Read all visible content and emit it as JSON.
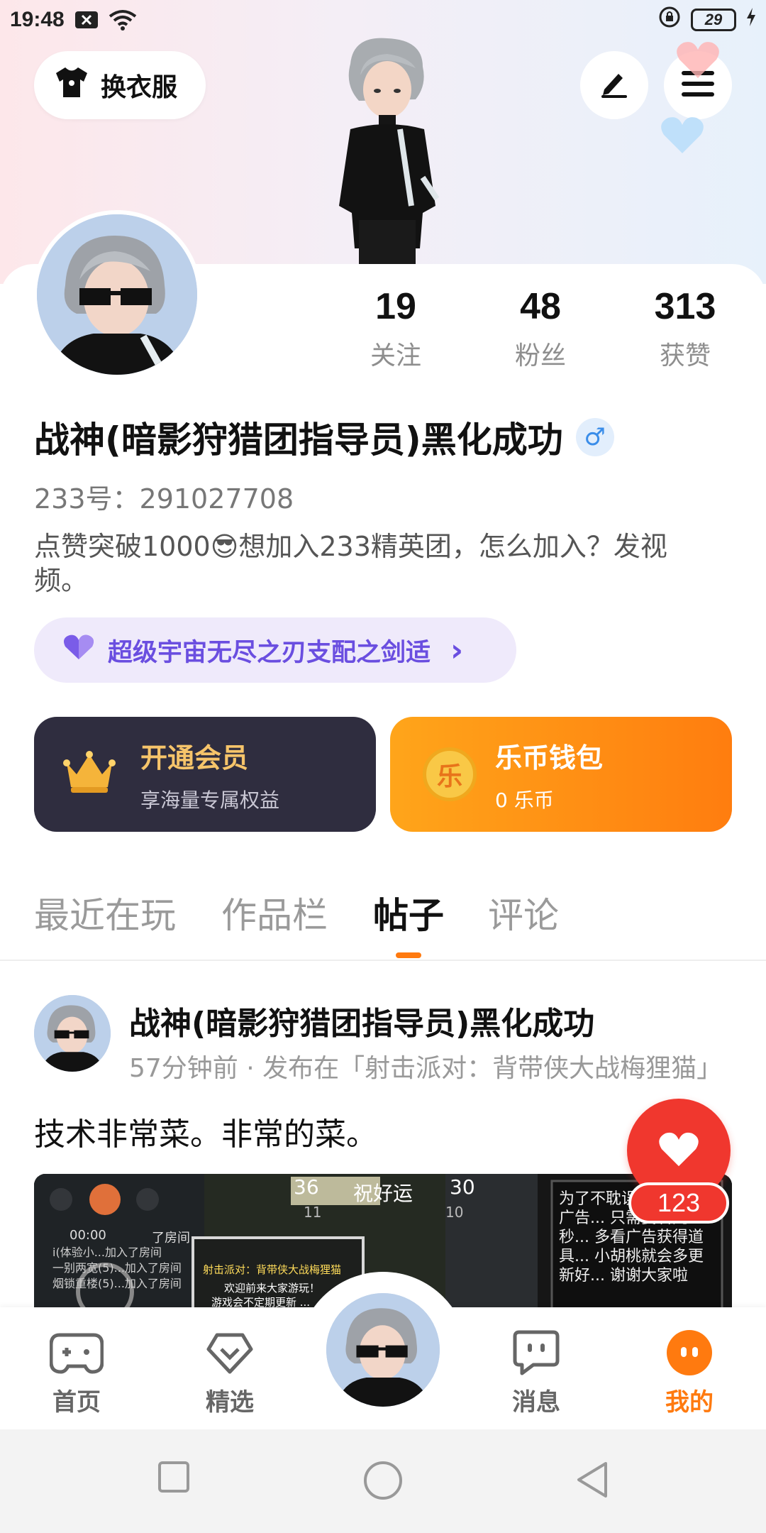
{
  "status_bar": {
    "time": "19:48",
    "battery": "29",
    "icons": [
      "notification-x-icon",
      "wifi-icon",
      "rotation-lock-icon",
      "charging-icon"
    ]
  },
  "header": {
    "outfit_button": "换衣服",
    "edit_icon": "pen-icon",
    "menu_icon": "hamburger-icon"
  },
  "profile": {
    "stats": [
      {
        "value": "19",
        "label": "关注"
      },
      {
        "value": "48",
        "label": "粉丝"
      },
      {
        "value": "313",
        "label": "获赞"
      }
    ],
    "username": "战神(暗影狩猎团指导员)黑化成功",
    "gender_symbol": "♂",
    "uid": "233号：291027708",
    "bio_part1": "点赞突破1000",
    "bio_emoji": "😎",
    "bio_part2": "想加入233精英团，怎么加入？发视频。",
    "title_chip": "超级宇宙无尽之刃支配之剑适",
    "title_chip_arrow": "›"
  },
  "cards": {
    "vip": {
      "title": "开通会员",
      "subtitle": "享海量专属权益"
    },
    "wallet": {
      "coin_glyph": "乐",
      "title": "乐币钱包",
      "subtitle": "0 乐币"
    }
  },
  "tabs": [
    {
      "label": "最近在玩",
      "active": false
    },
    {
      "label": "作品栏",
      "active": false
    },
    {
      "label": "帖子",
      "active": true
    },
    {
      "label": "评论",
      "active": false
    }
  ],
  "post": {
    "author": "战神(暗影狩猎团指导员)黑化成功",
    "meta": "57分钟前 · 发布在「射击派对：背带侠大战梅狸猫」",
    "text": "技术非常菜。非常的菜。",
    "image_overlay": {
      "score_left": "36",
      "center_banner": "祝好运",
      "score_right": "30",
      "players_left": "11",
      "players_right": "10",
      "timer": "00:00",
      "chat_lines": [
        "i(体验小...加入了房间",
        "一别两宽(5)...加入了房间",
        "烟锁重楼(5)...加入了房间"
      ],
      "room_join": "了房间",
      "board_title": "射击派对：背带侠大战梅狸猫",
      "board_line1": "欢迎前来大家游玩！",
      "board_line2": "游戏会不定期更新 ...",
      "sign_text": "为了不耽误... 这里的广告... 只需要看几秒... 多看广告获得道具... 小胡桃就会多更新好... 谢谢大家啦"
    },
    "like_count": "123"
  },
  "bottom_nav": [
    {
      "label": "首页",
      "icon": "gamepad-icon",
      "active": false
    },
    {
      "label": "精选",
      "icon": "heart-gem-icon",
      "active": false
    },
    {
      "label": "消息",
      "icon": "chat-bubble-icon",
      "active": false
    },
    {
      "label": "我的",
      "icon": "me-face-icon",
      "active": true
    }
  ],
  "colors": {
    "accent": "#ff7a0f",
    "like_red": "#f0372e",
    "vip_bg": "#2f2d3f",
    "wallet_orange": "#ff8c12",
    "title_chip_purple": "#6a4ee0"
  }
}
